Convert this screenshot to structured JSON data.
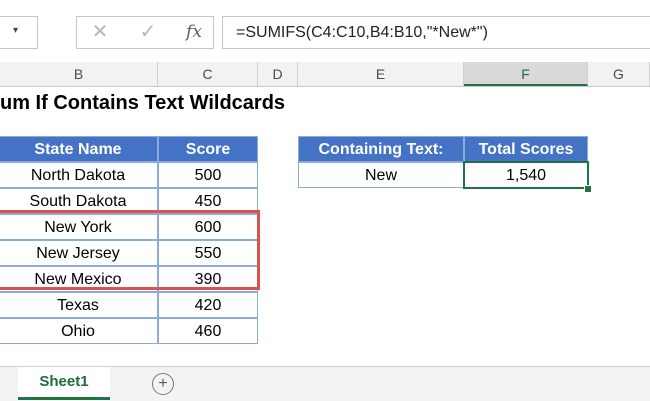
{
  "formula_bar": {
    "name_box_arrow_icon": "dropdown-arrow",
    "cancel_icon": "x-icon",
    "enter_icon": "check-icon",
    "fx_label": "fx",
    "formula": "=SUMIFS(C4:C10,B4:B10,\"*New*\")"
  },
  "columns": [
    "B",
    "C",
    "D",
    "E",
    "F",
    "G"
  ],
  "selected_column": "F",
  "sheet": {
    "title": "um If Contains Text Wildcards",
    "table1": {
      "headers": [
        "State Name",
        "Score"
      ],
      "rows": [
        [
          "North Dakota",
          "500"
        ],
        [
          "South Dakota",
          "450"
        ],
        [
          "New York",
          "600"
        ],
        [
          "New Jersey",
          "550"
        ],
        [
          "New Mexico",
          "390"
        ],
        [
          "Texas",
          "420"
        ],
        [
          "Ohio",
          "460"
        ]
      ]
    },
    "table2": {
      "headers": [
        "Containing Text:",
        "Total Scores"
      ],
      "row": [
        "New",
        "1,540"
      ]
    }
  },
  "tabs": {
    "sheet_name": "Sheet1",
    "add_icon": "plus-circle-icon"
  },
  "colors": {
    "header_fill": "#4472c4",
    "highlight": "#d9534f",
    "excel_green": "#217346"
  }
}
